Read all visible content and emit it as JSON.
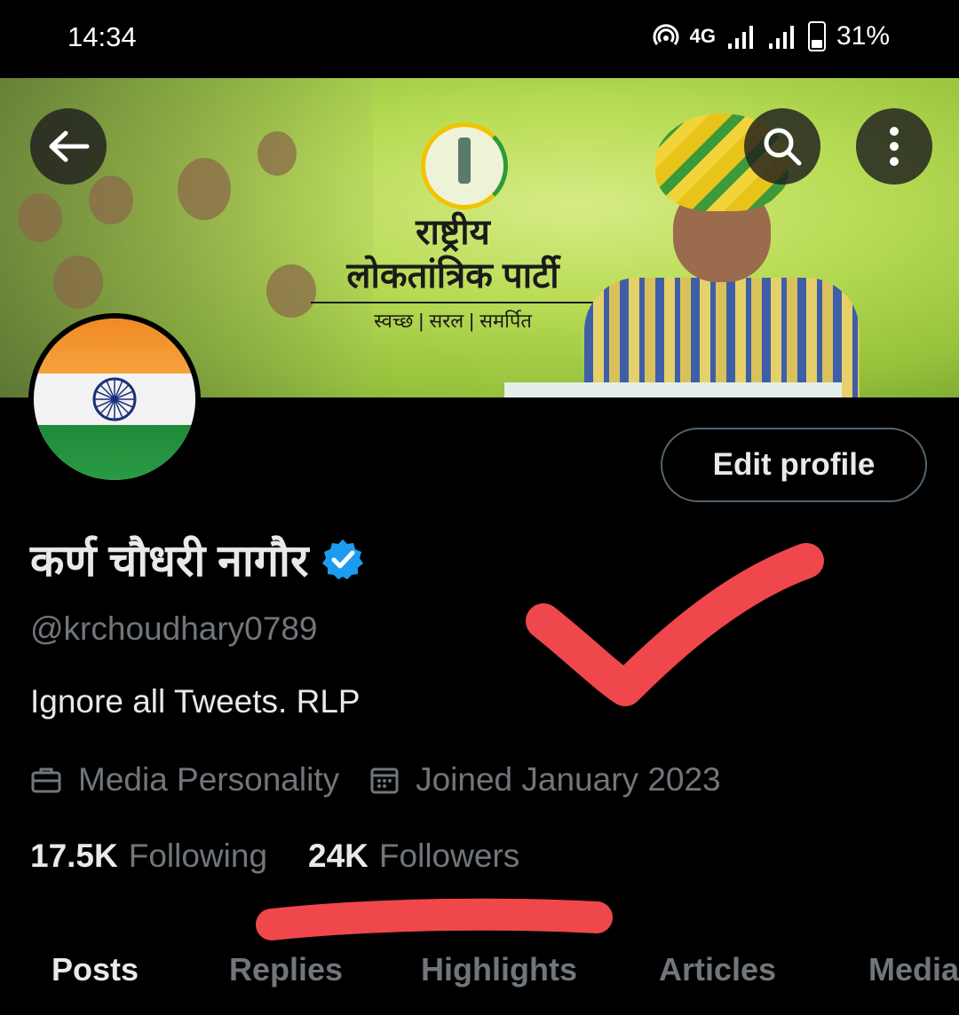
{
  "status_bar": {
    "time": "14:34",
    "network": "4G",
    "battery": "31%"
  },
  "banner": {
    "party_name_line1": "राष्ट्रीय",
    "party_name_line2": "लोकतांत्रिक पार्टी",
    "tagline": "स्वच्छ | सरल | समर्पित"
  },
  "header": {
    "back_icon": "back-arrow-icon",
    "search_icon": "search-icon",
    "more_icon": "more-vertical-icon"
  },
  "profile": {
    "edit_label": "Edit profile",
    "name": "कर्ण चौधरी नागौर",
    "verified_icon": "verified-badge-icon",
    "handle": "@krchoudhary0789",
    "bio": "Ignore all Tweets. RLP",
    "category": "Media Personality",
    "joined": "Joined January 2023",
    "following_count": "17.5K",
    "following_label": "Following",
    "followers_count": "24K",
    "followers_label": "Followers"
  },
  "tabs": [
    {
      "label": "Posts",
      "active": true
    },
    {
      "label": "Replies",
      "active": false
    },
    {
      "label": "Highlights",
      "active": false
    },
    {
      "label": "Articles",
      "active": false
    },
    {
      "label": "Media",
      "active": false
    }
  ],
  "colors": {
    "background": "#000000",
    "text": "#e7e9ea",
    "muted": "#71767b",
    "verified": "#1d9bf0",
    "annotation": "#f0474c"
  }
}
